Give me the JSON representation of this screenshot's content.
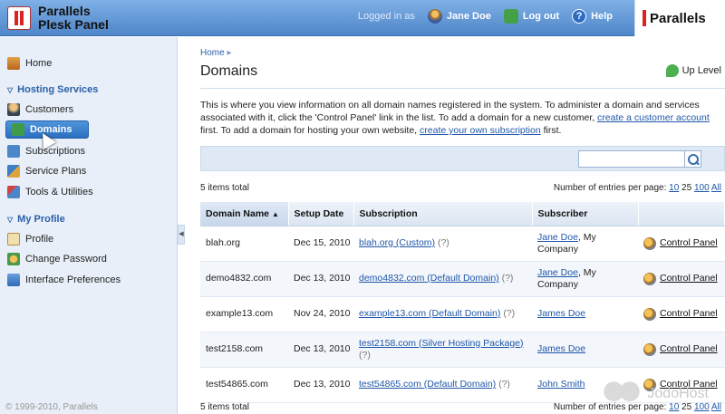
{
  "header": {
    "product_line1": "Parallels",
    "product_line2": "Plesk Panel",
    "logged_in_label": "Logged in as",
    "user_name": "Jane Doe",
    "logout_label": "Log out",
    "help_label": "Help",
    "brand": "Parallels"
  },
  "sidebar": {
    "home": "Home",
    "sections": [
      {
        "title": "Hosting Services",
        "items": [
          "Customers",
          "Domains",
          "Subscriptions",
          "Service Plans",
          "Tools & Utilities"
        ]
      },
      {
        "title": "My Profile",
        "items": [
          "Profile",
          "Change Password",
          "Interface Preferences"
        ]
      }
    ],
    "active_item": "Domains",
    "copyright": "© 1999-2010, Parallels"
  },
  "main": {
    "breadcrumb": "Home",
    "title": "Domains",
    "up_level": "Up Level",
    "desc_part1": "This is where you view information on all domain names registered in the system. To administer a domain and services associated with it, click the 'Control Panel' link in the list. To add a domain for a new customer, ",
    "desc_link1": "create a customer account",
    "desc_part2": " first. To add a domain for hosting your own website, ",
    "desc_link2": "create your own subscription",
    "desc_part3": " first.",
    "items_total": "5 items total",
    "per_page_label": "Number of entries per page:",
    "per_page_options": [
      "10",
      "25",
      "100",
      "All"
    ],
    "columns": [
      "Domain Name",
      "Setup Date",
      "Subscription",
      "Subscriber",
      ""
    ],
    "control_panel_label": "Control Panel",
    "rows": [
      {
        "domain": "blah.org",
        "date": "Dec 15, 2010",
        "subscription": "blah.org (Custom)",
        "sub_note": "(?)",
        "subscriber": "Jane Doe",
        "company": ", My Company"
      },
      {
        "domain": "demo4832.com",
        "date": "Dec 13, 2010",
        "subscription": "demo4832.com (Default Domain)",
        "sub_note": "(?)",
        "subscriber": "Jane Doe",
        "company": ", My Company"
      },
      {
        "domain": "example13.com",
        "date": "Nov 24, 2010",
        "subscription": "example13.com (Default Domain)",
        "sub_note": "(?)",
        "subscriber": "James Doe",
        "company": ""
      },
      {
        "domain": "test2158.com",
        "date": "Dec 13, 2010",
        "subscription": "test2158.com (Silver Hosting Package)",
        "sub_note": "(?)",
        "subscriber": "James Doe",
        "company": ""
      },
      {
        "domain": "test54865.com",
        "date": "Dec 13, 2010",
        "subscription": "test54865.com (Default Domain)",
        "sub_note": "(?)",
        "subscriber": "John Smith",
        "company": ""
      }
    ]
  },
  "watermark": "JodoHost"
}
